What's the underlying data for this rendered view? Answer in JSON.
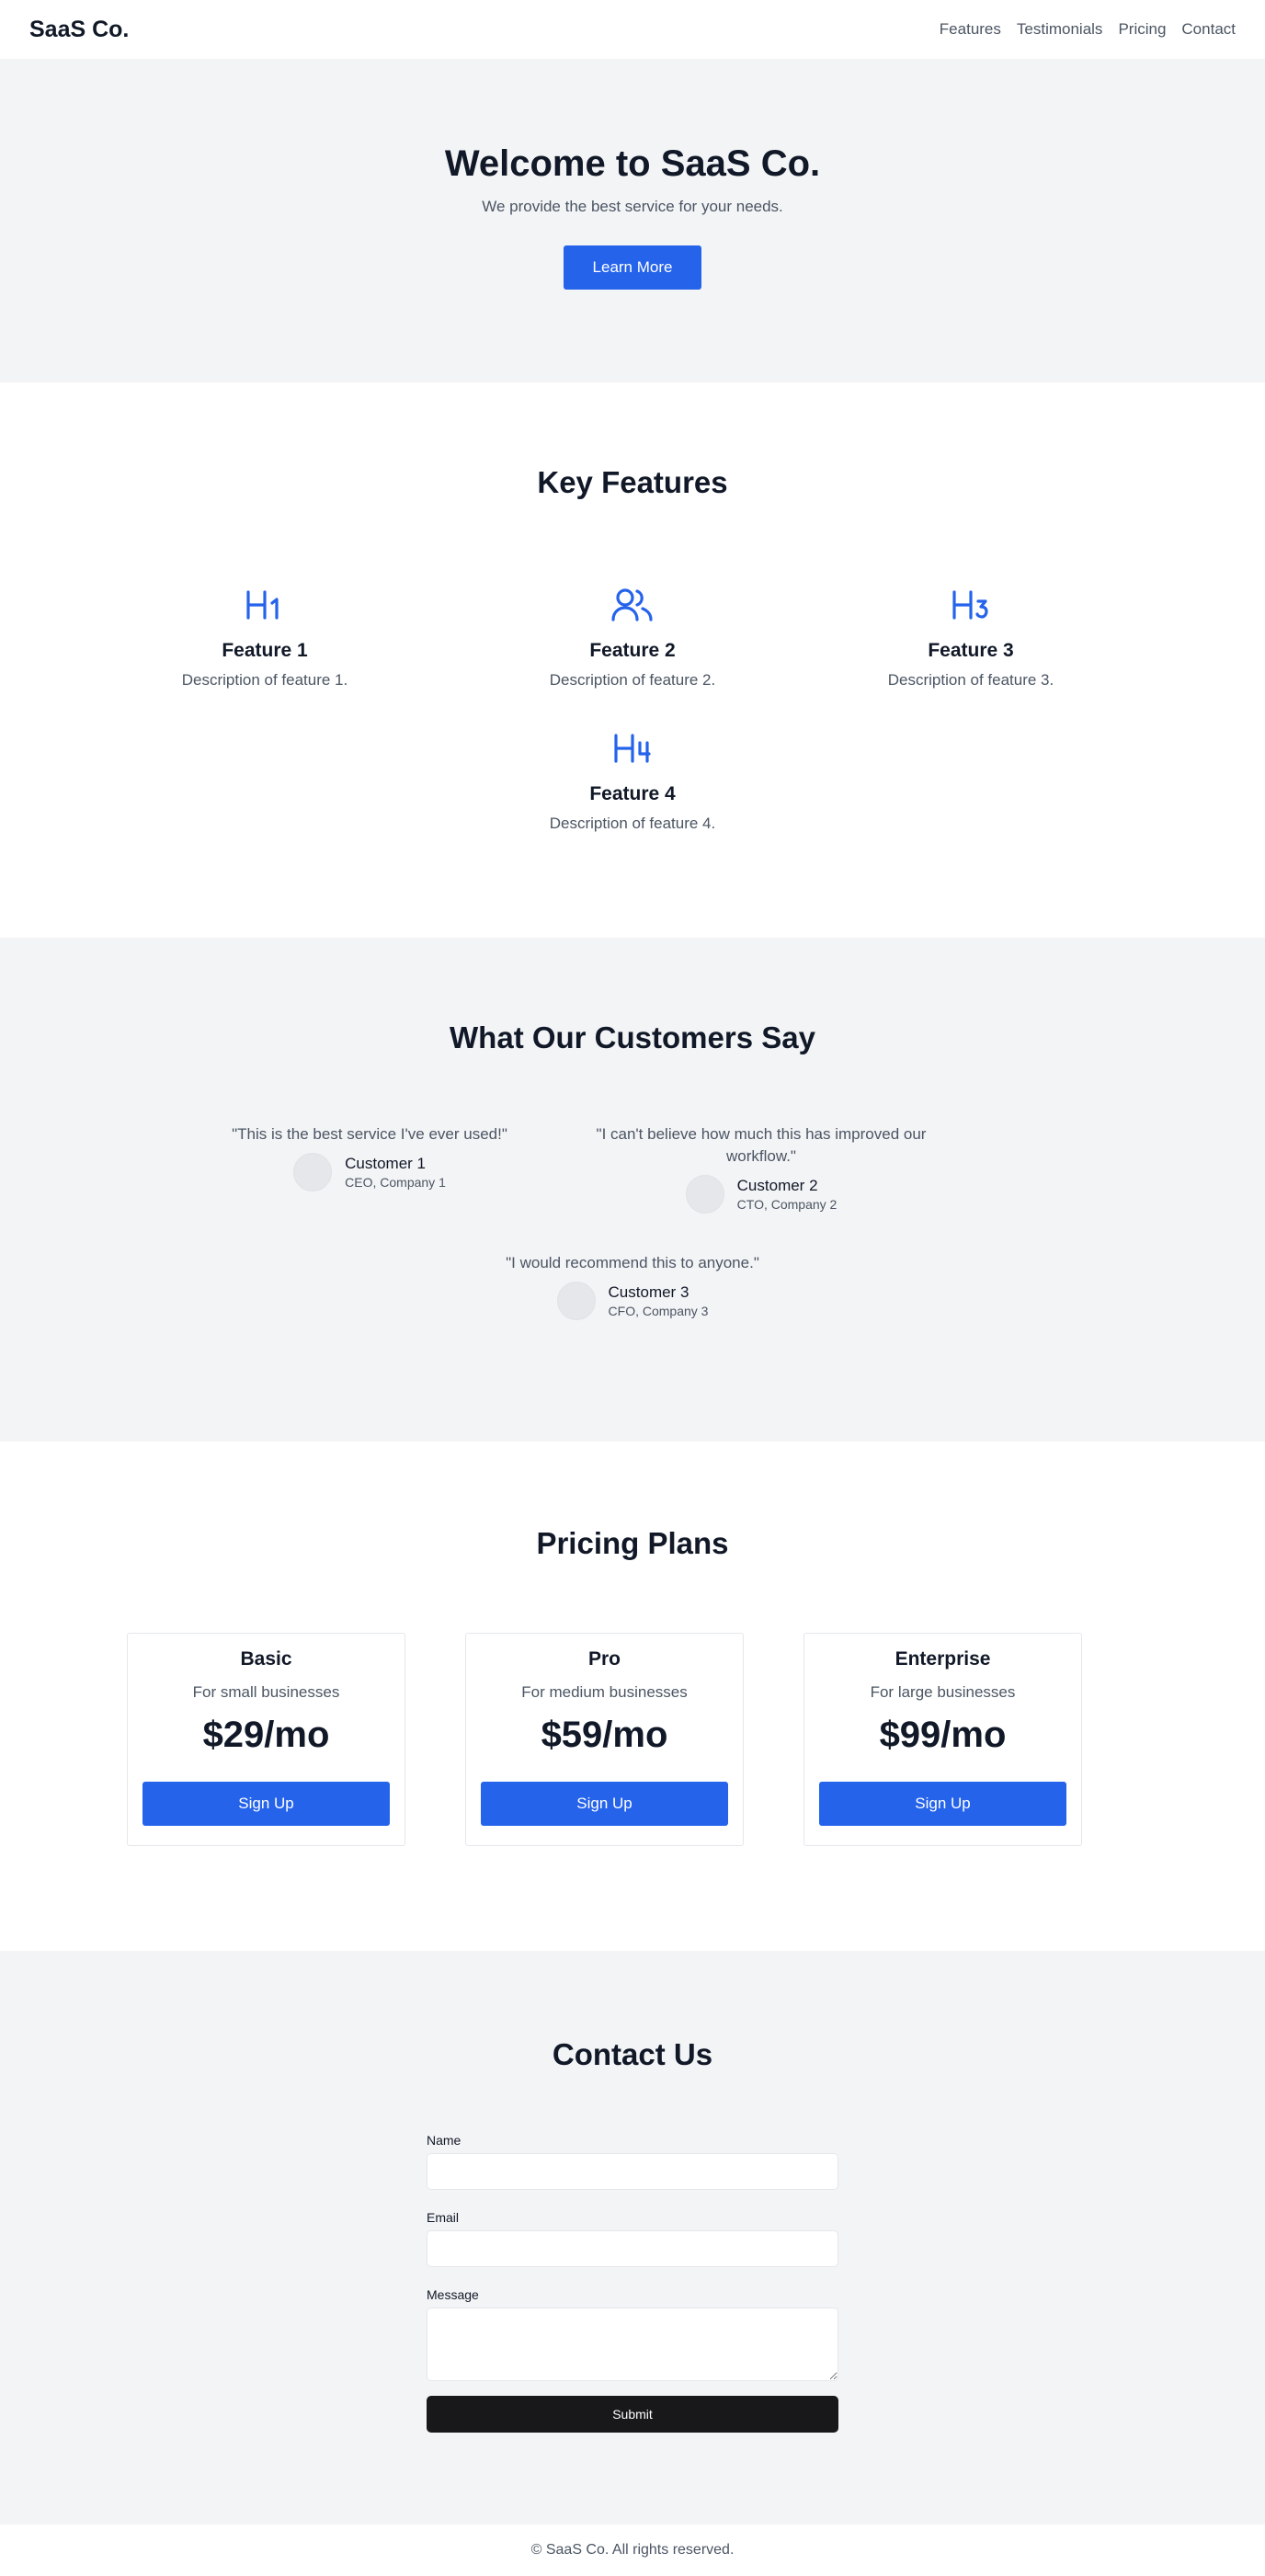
{
  "nav": {
    "brand": "SaaS Co.",
    "links": [
      "Features",
      "Testimonials",
      "Pricing",
      "Contact"
    ]
  },
  "hero": {
    "title": "Welcome to SaaS Co.",
    "subtitle": "We provide the best service for your needs.",
    "cta_label": "Learn More"
  },
  "features": {
    "title": "Key Features",
    "items": [
      {
        "icon": "heading-1-icon",
        "title": "Feature 1",
        "description": "Description of feature 1."
      },
      {
        "icon": "users-icon",
        "title": "Feature 2",
        "description": "Description of feature 2."
      },
      {
        "icon": "heading-3-icon",
        "title": "Feature 3",
        "description": "Description of feature 3."
      },
      {
        "icon": "heading-4-icon",
        "title": "Feature 4",
        "description": "Description of feature 4."
      }
    ]
  },
  "testimonials": {
    "title": "What Our Customers Say",
    "items": [
      {
        "quote": "\"This is the best service I've ever used!\"",
        "name": "Customer 1",
        "role": "CEO, Company 1"
      },
      {
        "quote": "\"I can't believe how much this has improved our workflow.\"",
        "name": "Customer 2",
        "role": "CTO, Company 2"
      },
      {
        "quote": "\"I would recommend this to anyone.\"",
        "name": "Customer 3",
        "role": "CFO, Company 3"
      }
    ]
  },
  "pricing": {
    "title": "Pricing Plans",
    "plans": [
      {
        "name": "Basic",
        "description": "For small businesses",
        "price": "$29/mo",
        "cta": "Sign Up"
      },
      {
        "name": "Pro",
        "description": "For medium businesses",
        "price": "$59/mo",
        "cta": "Sign Up"
      },
      {
        "name": "Enterprise",
        "description": "For large businesses",
        "price": "$99/mo",
        "cta": "Sign Up"
      }
    ]
  },
  "contact": {
    "title": "Contact Us",
    "name_label": "Name",
    "name_value": "",
    "email_label": "Email",
    "email_value": "",
    "message_label": "Message",
    "message_value": "",
    "submit_label": "Submit"
  },
  "footer": {
    "text": "© SaaS Co. All rights reserved."
  },
  "colors": {
    "accent": "#2563eb",
    "section_gray": "#f3f4f6",
    "submit_dark": "#18181b"
  }
}
